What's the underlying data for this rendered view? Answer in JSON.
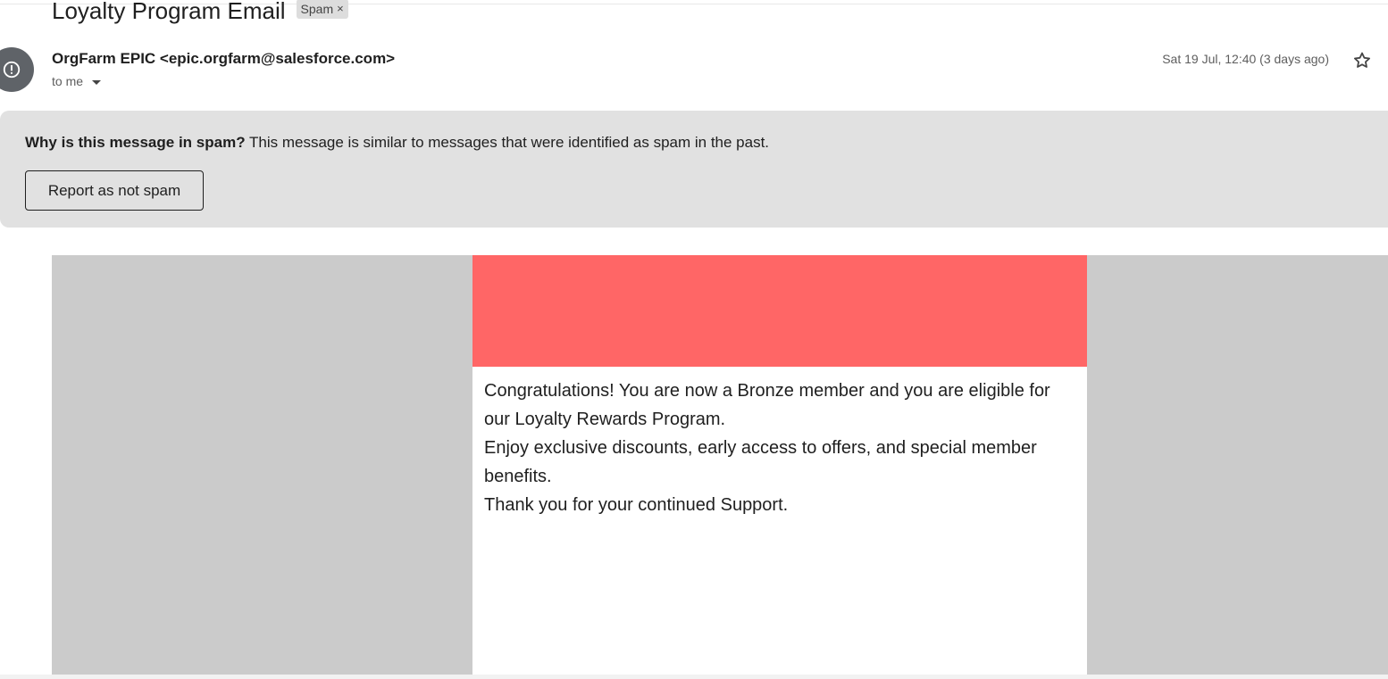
{
  "subject": {
    "title": "Loyalty Program Email",
    "label": "Spam",
    "label_remove": "×"
  },
  "sender": {
    "display": "OrgFarm EPIC <epic.orgfarm@salesforce.com>",
    "recipient": "to me",
    "date": "Sat 19 Jul, 12:40 (3 days ago)"
  },
  "spam_warning": {
    "heading": "Why is this message in spam?",
    "reason": "This message is similar to messages that were identified as spam in the past.",
    "button_label": "Report as not spam"
  },
  "email_body": {
    "banner_color": "#ff6666",
    "side_color": "#cbcbcb",
    "paragraphs": [
      "Congratulations! You are now a Bronze member and you are eligible for our Loyalty Rewards Program.",
      "Enjoy exclusive discounts, early access to offers, and special member benefits.",
      "Thank you for your continued Support."
    ]
  },
  "icons": {
    "avatar": "alert-circle-icon",
    "recipient_toggle": "caret-down-icon",
    "star": "star-outline-icon"
  }
}
